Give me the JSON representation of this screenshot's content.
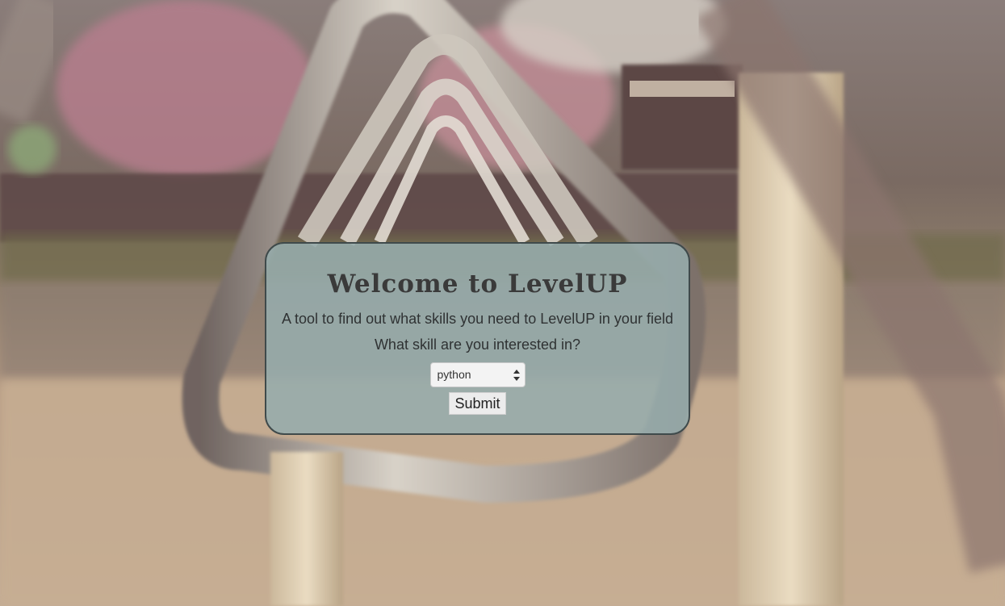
{
  "card": {
    "title": "Welcome to LevelUP",
    "tagline": "A tool to find out what skills you need to LevelUP in your field",
    "question": "What skill are you interested in?"
  },
  "skill_select": {
    "selected": "python",
    "icon": "select-arrows-icon"
  },
  "submit": {
    "label": "Submit"
  },
  "colors": {
    "card_background": "#96acac",
    "card_border": "#3f4a4b",
    "title_text": "#3a3a3a"
  }
}
